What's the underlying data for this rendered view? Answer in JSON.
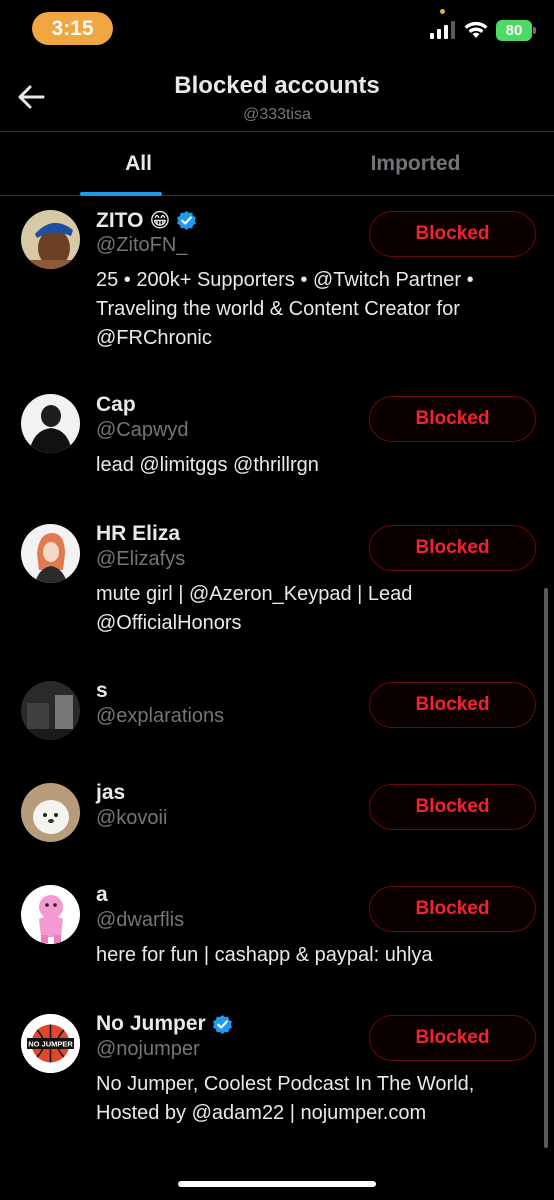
{
  "status_bar": {
    "time": "3:15",
    "battery": "80"
  },
  "header": {
    "title": "Blocked accounts",
    "subtitle": "@333tisa"
  },
  "tabs": [
    {
      "label": "All"
    },
    {
      "label": "Imported"
    }
  ],
  "accounts": [
    {
      "name": "ZITO",
      "emoji": "😁",
      "verified": true,
      "handle": "@ZitoFN_",
      "bio": "25 • 200k+ Supporters • @Twitch Partner • Traveling the world & Content Creator for @FRChronic",
      "button": "Blocked"
    },
    {
      "name": "Cap",
      "verified": false,
      "handle": "@Capwyd",
      "bio": "lead @limitggs @thrillrgn",
      "button": "Blocked"
    },
    {
      "name": "HR Eliza",
      "verified": false,
      "handle": "@Elizafys",
      "bio": "mute girl | @Azeron_Keypad | Lead @OfficialHonors",
      "button": "Blocked"
    },
    {
      "name": "s",
      "verified": false,
      "handle": "@explarations",
      "bio": "",
      "button": "Blocked"
    },
    {
      "name": "jas",
      "verified": false,
      "handle": "@kovoii",
      "bio": "",
      "button": "Blocked"
    },
    {
      "name": "a",
      "verified": false,
      "handle": "@dwarflis",
      "bio": "here for fun | cashapp & paypal: uhlya",
      "button": "Blocked"
    },
    {
      "name": "No Jumper",
      "verified": true,
      "handle": "@nojumper",
      "bio": "No Jumper, Coolest Podcast In The World, Hosted by @adam22 | nojumper.com",
      "button": "Blocked",
      "avatar_text": "NO JUMPER"
    }
  ],
  "colors": {
    "accent": "#1d9bf0",
    "danger": "#f4212e",
    "muted": "#71767b",
    "background": "#000000"
  }
}
